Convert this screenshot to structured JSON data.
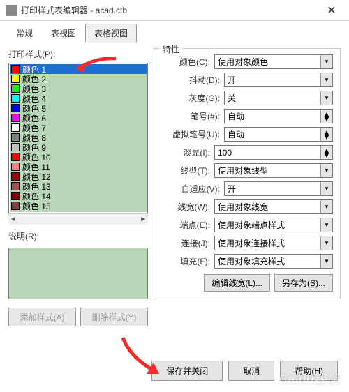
{
  "window": {
    "title": "打印样式表编辑器 - acad.ctb",
    "close": "✕"
  },
  "tabs": {
    "general": "常规",
    "table": "表视图",
    "formTable": "表格视图"
  },
  "left": {
    "printStylesLabel": "打印样式(P):",
    "items": [
      {
        "swatch": "#ff0000",
        "label": "颜色 1"
      },
      {
        "swatch": "#ffff00",
        "label": "颜色 2"
      },
      {
        "swatch": "#00ff00",
        "label": "颜色 3"
      },
      {
        "swatch": "#00ffff",
        "label": "颜色 4"
      },
      {
        "swatch": "#0000ff",
        "label": "颜色 5"
      },
      {
        "swatch": "#ff00ff",
        "label": "颜色 6"
      },
      {
        "swatch": "#ffffff",
        "label": "颜色 7"
      },
      {
        "swatch": "#808080",
        "label": "颜色 8"
      },
      {
        "swatch": "#c0c0c0",
        "label": "颜色 9"
      },
      {
        "swatch": "#ff0000",
        "label": "颜色 10"
      },
      {
        "swatch": "#ff8080",
        "label": "颜色 11"
      },
      {
        "swatch": "#a00000",
        "label": "颜色 12"
      },
      {
        "swatch": "#a05050",
        "label": "颜色 13"
      },
      {
        "swatch": "#800000",
        "label": "颜色 14"
      },
      {
        "swatch": "#804040",
        "label": "颜色 15"
      }
    ],
    "descLabel": "说明(R):",
    "addStyle": "添加样式(A)",
    "deleteStyle": "删除样式(Y)"
  },
  "props": {
    "groupTitle": "特性",
    "rows": [
      {
        "label": "颜色(C):",
        "value": "使用对象颜色",
        "type": "dd"
      },
      {
        "label": "抖动(D):",
        "value": "开",
        "type": "dd"
      },
      {
        "label": "灰度(G):",
        "value": "关",
        "type": "dd"
      },
      {
        "label": "笔号(#):",
        "value": "自动",
        "type": "spin"
      },
      {
        "label": "虚拟笔号(U):",
        "value": "自动",
        "type": "spin"
      },
      {
        "label": "淡显(I):",
        "value": "100",
        "type": "spin"
      },
      {
        "label": "线型(T):",
        "value": "使用对象线型",
        "type": "dd"
      },
      {
        "label": "自适应(V):",
        "value": "开",
        "type": "dd"
      },
      {
        "label": "线宽(W):",
        "value": "使用对象线宽",
        "type": "dd"
      },
      {
        "label": "端点(E):",
        "value": "使用对象端点样式",
        "type": "dd"
      },
      {
        "label": "连接(J):",
        "value": "使用对象连接样式",
        "type": "dd"
      },
      {
        "label": "填充(F):",
        "value": "使用对象填充样式",
        "type": "dd"
      }
    ],
    "editLineweight": "编辑线宽(L)...",
    "saveAs": "另存为(S)..."
  },
  "bottom": {
    "saveClose": "保存并关闭",
    "cancel": "取消",
    "help": "帮助(H)"
  },
  "watermark": "Baidu经验"
}
